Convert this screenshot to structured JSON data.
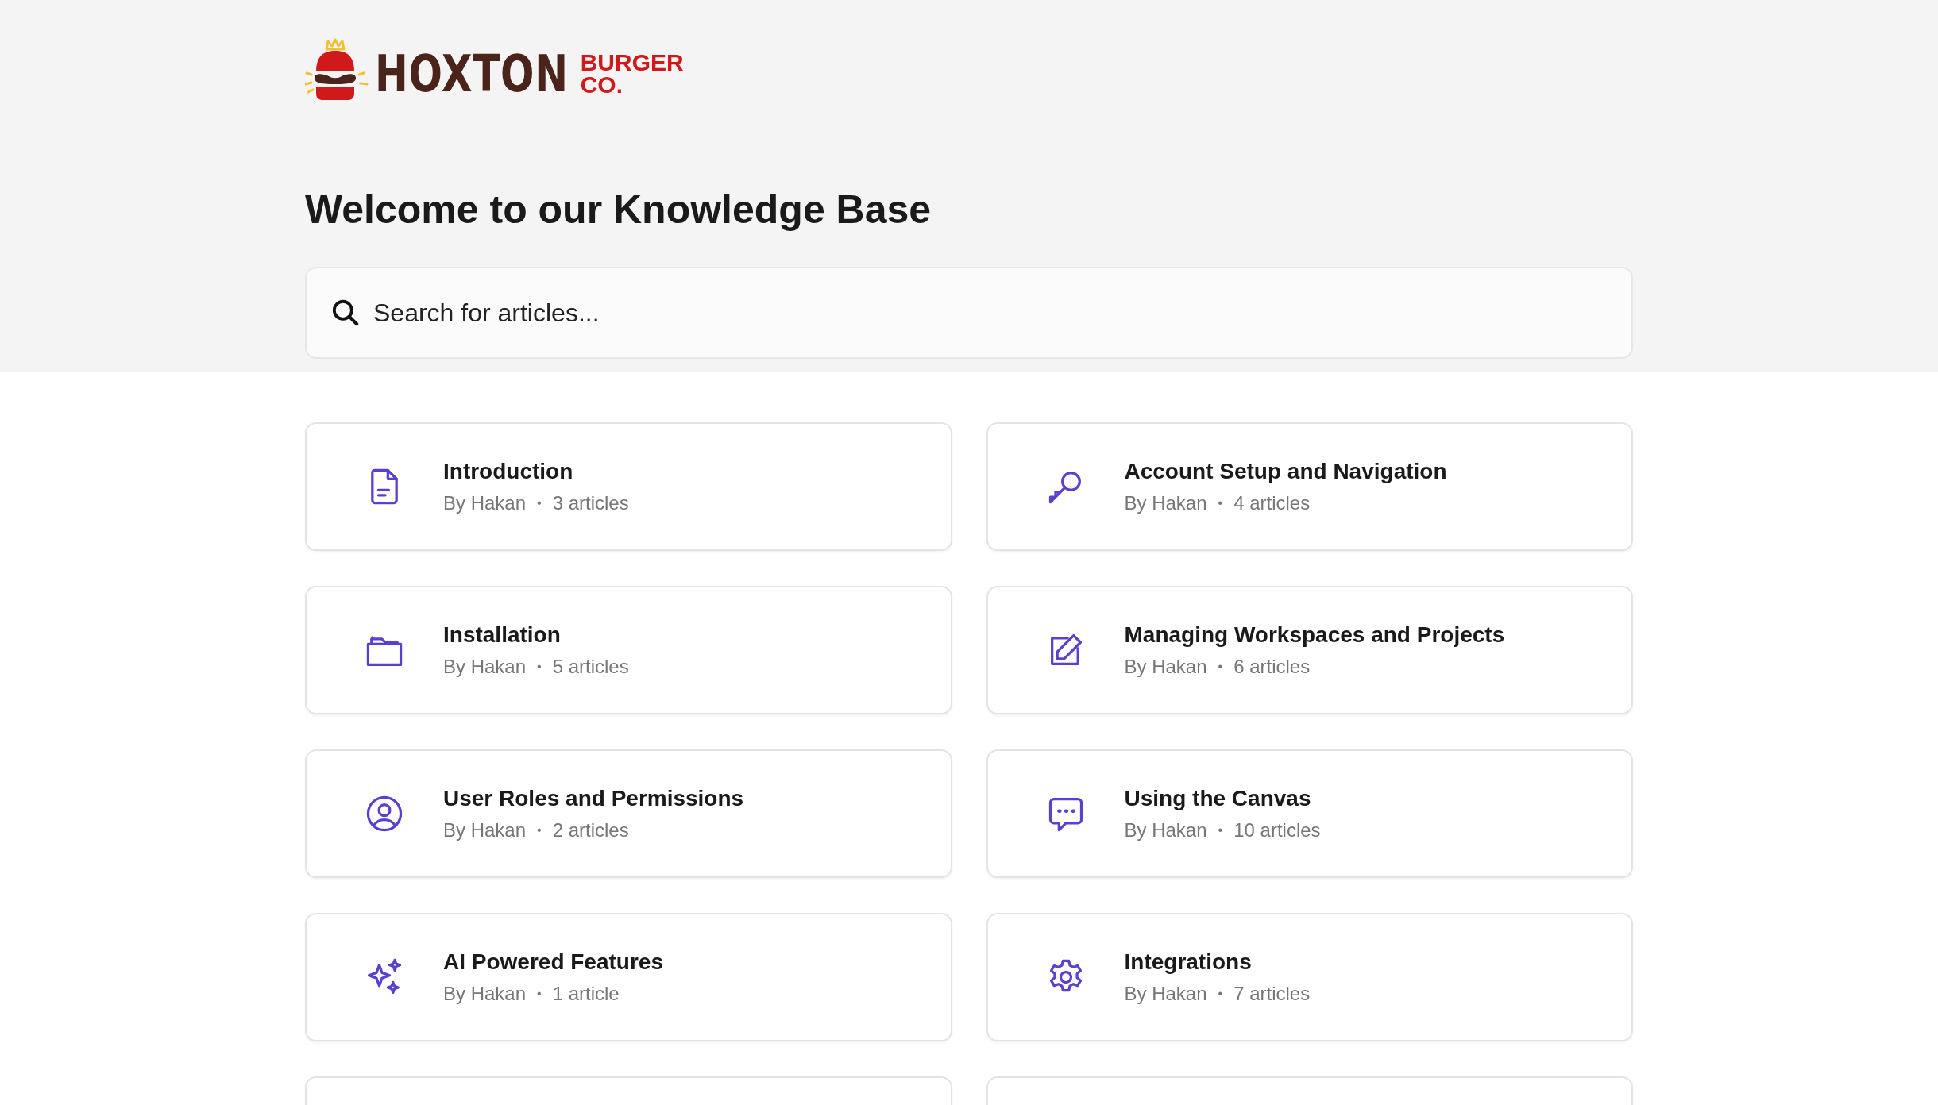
{
  "logo": {
    "name": "HOXTON",
    "line_1": "BURGER",
    "line_2": "CO."
  },
  "heading": "Welcome to our Knowledge Base",
  "search": {
    "placeholder": "Search for articles..."
  },
  "collections": [
    {
      "title": "Introduction",
      "author": "By Hakan",
      "separator": "•",
      "count": "3 articles"
    },
    {
      "title": "Account Setup and Navigation",
      "author": "By Hakan",
      "separator": "•",
      "count": "4 articles"
    },
    {
      "title": "Installation",
      "author": "By Hakan",
      "separator": "•",
      "count": "5 articles"
    },
    {
      "title": "Managing Workspaces and Projects",
      "author": "By Hakan",
      "separator": "•",
      "count": "6 articles"
    },
    {
      "title": "User Roles and Permissions",
      "author": "By Hakan",
      "separator": "•",
      "count": "2 articles"
    },
    {
      "title": "Using the Canvas",
      "author": "By Hakan",
      "separator": "•",
      "count": "10 articles"
    },
    {
      "title": "AI Powered Features",
      "author": "By Hakan",
      "separator": "•",
      "count": "1 article"
    },
    {
      "title": "Integrations",
      "author": "By Hakan",
      "separator": "•",
      "count": "7 articles"
    }
  ]
}
